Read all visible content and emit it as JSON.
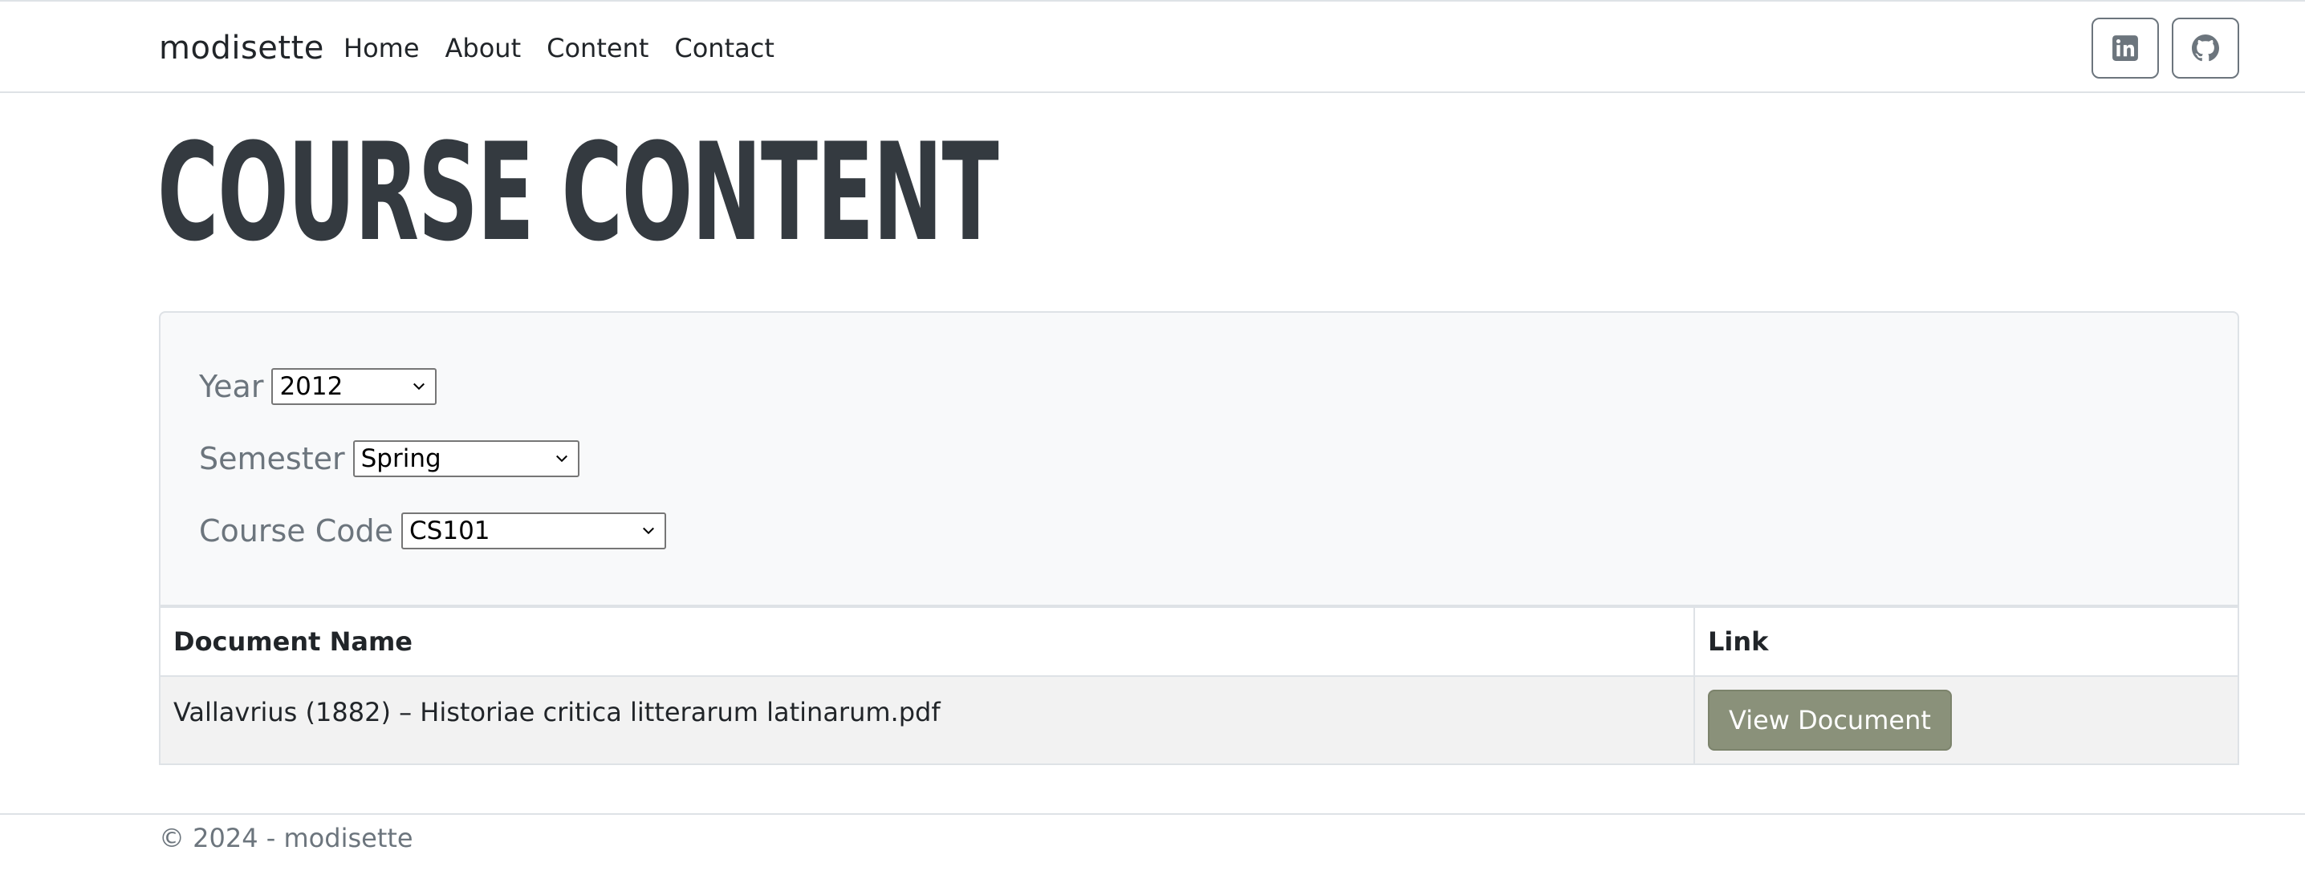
{
  "navbar": {
    "brand": "modisette",
    "links": [
      {
        "label": "Home"
      },
      {
        "label": "About"
      },
      {
        "label": "Content"
      },
      {
        "label": "Contact"
      }
    ],
    "social": [
      {
        "icon": "linkedin-icon"
      },
      {
        "icon": "github-icon"
      }
    ]
  },
  "page": {
    "title": "Course Content"
  },
  "filters": {
    "year": {
      "label": "Year",
      "value": "2012"
    },
    "semester": {
      "label": "Semester",
      "value": "Spring"
    },
    "course_code": {
      "label": "Course Code",
      "value": "CS101"
    }
  },
  "table": {
    "headers": [
      "Document Name",
      "Link"
    ],
    "rows": [
      {
        "document_name": "Vallavrius (1882) – Historiae critica litterarum latinarum.pdf",
        "link_label": "View Document"
      }
    ]
  },
  "footer": {
    "text": "© 2024 - modisette"
  },
  "colors": {
    "button_bg": "#8a917a",
    "title": "#343a40",
    "muted": "#6c757d",
    "panel_bg": "#f8f9fa",
    "row_bg": "#f2f2f2"
  }
}
